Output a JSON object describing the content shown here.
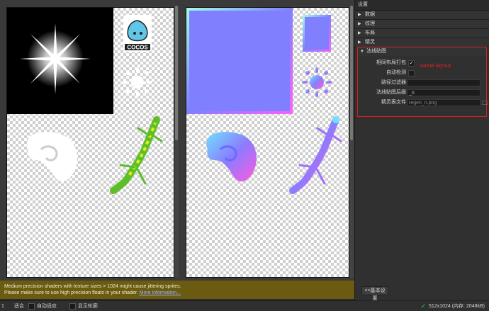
{
  "viewport": {
    "warning_line1": "Medium precision shaders with texture sizes > 1024 might cause jittering sprites.",
    "warning_line2": "Please make sure to use high precision floats in your shader.",
    "warning_link": "More information..."
  },
  "logo_text": "COCOS",
  "statusbar": {
    "zoom_value": "1",
    "fit_label": "适合",
    "auto_fit_label": "自动适应",
    "show_outline_label": "显示轮廓",
    "size_info": "512x1024 (内存: 2048kB)"
  },
  "sidebar": {
    "title": "设置",
    "sections": [
      {
        "label": "数据"
      },
      {
        "label": "纹理"
      },
      {
        "label": "布局"
      },
      {
        "label": "精灵"
      }
    ],
    "normal_map": {
      "header": "法线贴图",
      "annotation": "same layout",
      "rows": {
        "pack_same_layout": "相同布局打包",
        "auto_detect": "自动检测",
        "path_filter": "路径过滤器",
        "suffix": "法线贴图后缀",
        "suffix_value": "_n",
        "sheet_file": "精灵表文件",
        "sheet_file_value": "regen_n.png"
      }
    },
    "basic_settings_button": "<<基本设置"
  },
  "colors": {
    "accent_red": "#d81e1e",
    "warning_bg": "#6b5b10",
    "normal_map_blue": "#8080ff",
    "lizard_green": "#5cbf2a",
    "lizard_yellow": "#e8e81a"
  }
}
